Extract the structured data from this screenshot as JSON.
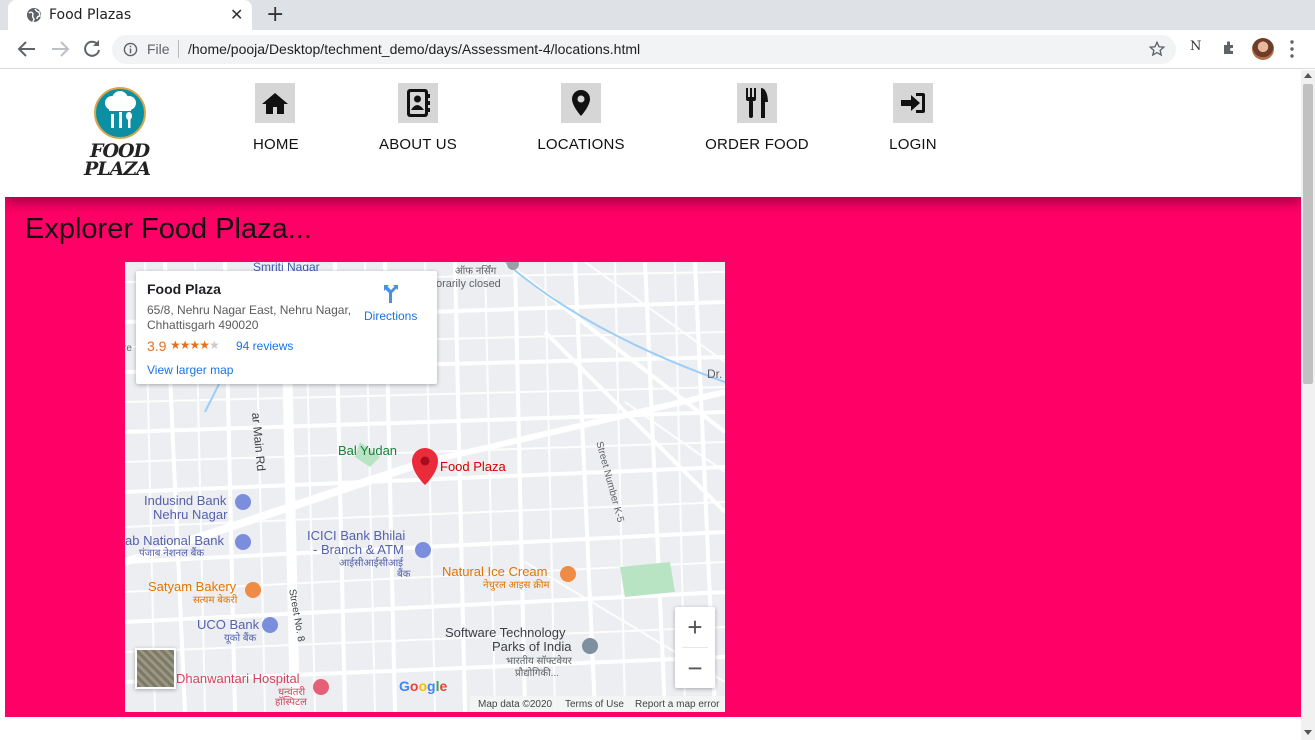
{
  "browser": {
    "tab_title": "Food Plazas",
    "tab_close": "✕",
    "new_tab": "+",
    "file_label": "File",
    "url": "/home/pooja/Desktop/techment_demo/days/Assessment-4/locations.html",
    "ext_text": "N"
  },
  "header": {
    "logo_text_line1": "FOOD",
    "logo_text_line2": "PLAZA",
    "nav": [
      {
        "label": "HOME",
        "icon": "home-icon"
      },
      {
        "label": "ABOUT US",
        "icon": "contacts-book-icon"
      },
      {
        "label": "LOCATIONS",
        "icon": "map-pin-icon"
      },
      {
        "label": "ORDER FOOD",
        "icon": "utensils-icon"
      },
      {
        "label": "LOGIN",
        "icon": "sign-in-icon"
      }
    ]
  },
  "main": {
    "heading": "Explorer Food Plaza...",
    "bg_color": "#ff0066"
  },
  "map": {
    "place_name": "Food Plaza",
    "address": "65/8, Nehru Nagar East, Nehru Nagar, Chhattisgarh 490020",
    "rating": "3.9",
    "stars": "★★★★",
    "star_empty": "★",
    "reviews": "94 reviews",
    "larger_link": "View larger map",
    "directions": "Directions",
    "zoom_in": "+",
    "zoom_out": "−",
    "google": "Google",
    "attribution": {
      "map_data": "Map data ©2020",
      "terms": "Terms of Use",
      "report": "Report a map error"
    },
    "labels": {
      "smriti": "Smriti Nagar",
      "hindi_top": "ऑफ नर्सिंग",
      "temp_closed": "orarily closed",
      "main_rd": "ar Main Rd",
      "dr": "Dr.",
      "bal_yudan": "Bal Yudan",
      "pin_label": "Food Plaza",
      "street_k5": "Street Number K-5",
      "indusind_1": "Indusind Bank",
      "indusind_2": "Nehru Nagar",
      "pnb_1": "ab National Bank",
      "pnb_2": "पंजाब नेशनल बैंक",
      "icici_1": "ICICI Bank Bhilai",
      "icici_2": "- Branch & ATM",
      "icici_3": "आईसीआईसीआई",
      "icici_4": "बैंक",
      "natural_1": "Natural Ice Cream",
      "natural_2": "नेचुरल आइस क्रीम",
      "satyam_1": "Satyam Bakery",
      "satyam_2": "सत्यम बेकरी",
      "street8": "Street No. 8",
      "uco_1": "UCO Bank",
      "uco_2": "यूको बैंक",
      "stp_1": "Software Technology",
      "stp_2": "Parks of India",
      "stp_3": "भारतीय सॉफ्टवेयर",
      "stp_4": "प्रौद्योगिकी...",
      "dhan_1": "Dhanwantari Hospital",
      "dhan_2": "धन्वंतरी",
      "dhan_3": "हॉस्पिटल",
      "nehru_re": "re"
    }
  }
}
